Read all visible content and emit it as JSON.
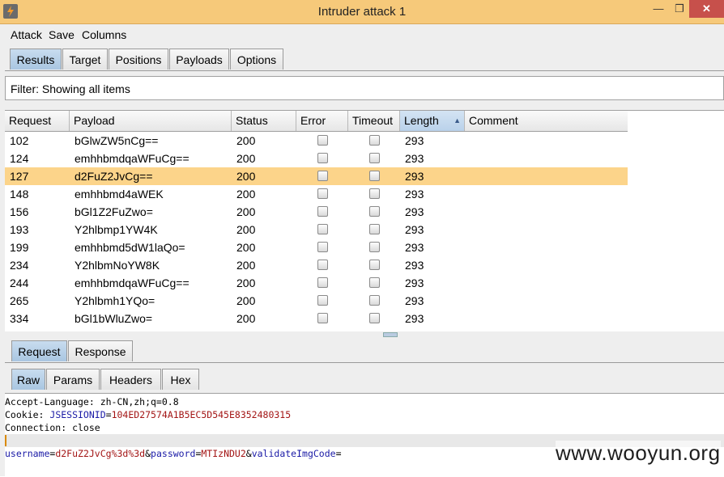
{
  "window": {
    "title": "Intruder attack 1",
    "minimize": "—",
    "maximize": "❐",
    "close": "✕"
  },
  "menu": [
    "Attack",
    "Save",
    "Columns"
  ],
  "main_tabs": [
    {
      "label": "Results",
      "active": true
    },
    {
      "label": "Target",
      "active": false
    },
    {
      "label": "Positions",
      "active": false
    },
    {
      "label": "Payloads",
      "active": false
    },
    {
      "label": "Options",
      "active": false
    }
  ],
  "filter": {
    "text": "Filter: Showing all items"
  },
  "table": {
    "columns": [
      "Request",
      "Payload",
      "Status",
      "Error",
      "Timeout",
      "Length",
      "Comment"
    ],
    "sorted_column": "Length",
    "sort_arrow": "▲",
    "selected_request": "127",
    "rows": [
      {
        "request": "102",
        "payload": "bGlwZW5nCg==",
        "status": "200",
        "length": "293"
      },
      {
        "request": "124",
        "payload": "emhhbmdqaWFuCg==",
        "status": "200",
        "length": "293"
      },
      {
        "request": "127",
        "payload": "d2FuZ2JvCg==",
        "status": "200",
        "length": "293"
      },
      {
        "request": "148",
        "payload": "emhhbmd4aWEK",
        "status": "200",
        "length": "293"
      },
      {
        "request": "156",
        "payload": "bGl1Z2FuZwo=",
        "status": "200",
        "length": "293"
      },
      {
        "request": "193",
        "payload": "Y2hlbmp1YW4K",
        "status": "200",
        "length": "293"
      },
      {
        "request": "199",
        "payload": "emhhbmd5dW1laQo=",
        "status": "200",
        "length": "293"
      },
      {
        "request": "234",
        "payload": "Y2hlbmNoYW8K",
        "status": "200",
        "length": "293"
      },
      {
        "request": "244",
        "payload": "emhhbmdqaWFuCg==",
        "status": "200",
        "length": "293"
      },
      {
        "request": "265",
        "payload": "Y2hlbmh1YQo=",
        "status": "200",
        "length": "293"
      },
      {
        "request": "334",
        "payload": "bGl1bWluZwo=",
        "status": "200",
        "length": "293"
      }
    ]
  },
  "detail_tabs": [
    {
      "label": "Request",
      "active": true
    },
    {
      "label": "Response",
      "active": false
    }
  ],
  "view_tabs": [
    {
      "label": "Raw",
      "active": true
    },
    {
      "label": "Params",
      "active": false
    },
    {
      "label": "Headers",
      "active": false
    },
    {
      "label": "Hex",
      "active": false
    }
  ],
  "raw": {
    "accept_language": "Accept-Language: zh-CN,zh;q=0.8",
    "cookie_prefix": "Cookie: ",
    "cookie_name": "JSESSIONID",
    "cookie_eq": "=",
    "cookie_value": "104ED27574A1B5EC5D545E8352480315",
    "connection": "Connection: close",
    "body_parts": [
      {
        "kind": "name",
        "text": "username"
      },
      {
        "kind": "eq",
        "text": "="
      },
      {
        "kind": "value",
        "text": "d2FuZ2JvCg%3d%3d"
      },
      {
        "kind": "eq",
        "text": "&"
      },
      {
        "kind": "name",
        "text": "password"
      },
      {
        "kind": "eq",
        "text": "="
      },
      {
        "kind": "value",
        "text": "MTIzNDU2"
      },
      {
        "kind": "eq",
        "text": "&"
      },
      {
        "kind": "name",
        "text": "validateImgCode"
      },
      {
        "kind": "eq",
        "text": "="
      }
    ]
  },
  "watermark": "www.wooyun.org"
}
